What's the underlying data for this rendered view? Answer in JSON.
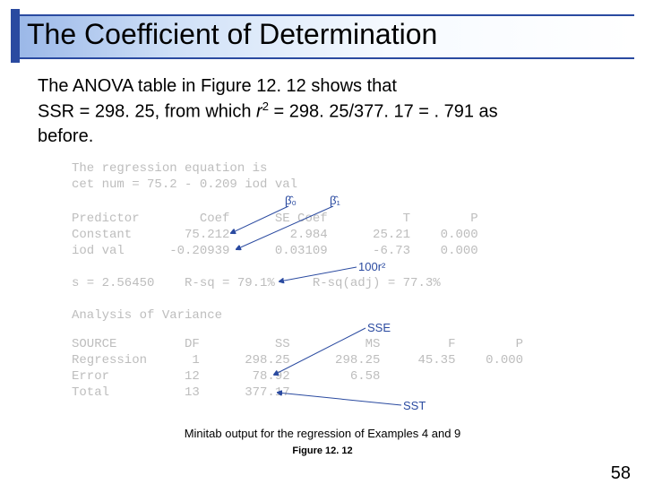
{
  "title": "The Coefficient of Determination",
  "body": {
    "line1": "The ANOVA table in Figure 12. 12 shows that",
    "line2a": "SSR = 298. 25, from which ",
    "line2_r": "r",
    "line2_sup": "2",
    "line2b": " = 298. 25/377. 17 = . 791 as",
    "line3": "before."
  },
  "caption": "Minitab output for the regression of Examples 4 and 9",
  "figure_label": "Figure 12. 12",
  "page_number": "58",
  "annotations": {
    "b0": "β̂₀",
    "b1": "β̂₁",
    "r2": "100r²",
    "sse": "SSE",
    "sst": "SST"
  },
  "minitab": {
    "l1": "The regression equation is",
    "l2": "cet num = 75.2 - 0.209 iod val",
    "hdr": "Predictor        Coef      SE Coef          T        P",
    "constant": "Constant       75.212        2.984      25.21    0.000",
    "iodval": "iod val      -0.20939      0.03109      -6.73    0.000",
    "sline": "s = 2.56450    R-sq = 79.1%     R-sq(adj) = 77.3%",
    "aov": "Analysis of Variance",
    "thdr": "SOURCE         DF          SS          MS         F        P",
    "treg": "Regression      1      298.25      298.25     45.35    0.000",
    "terr": "Error          12       78.92        6.58",
    "ttot": "Total          13      377.17"
  }
}
